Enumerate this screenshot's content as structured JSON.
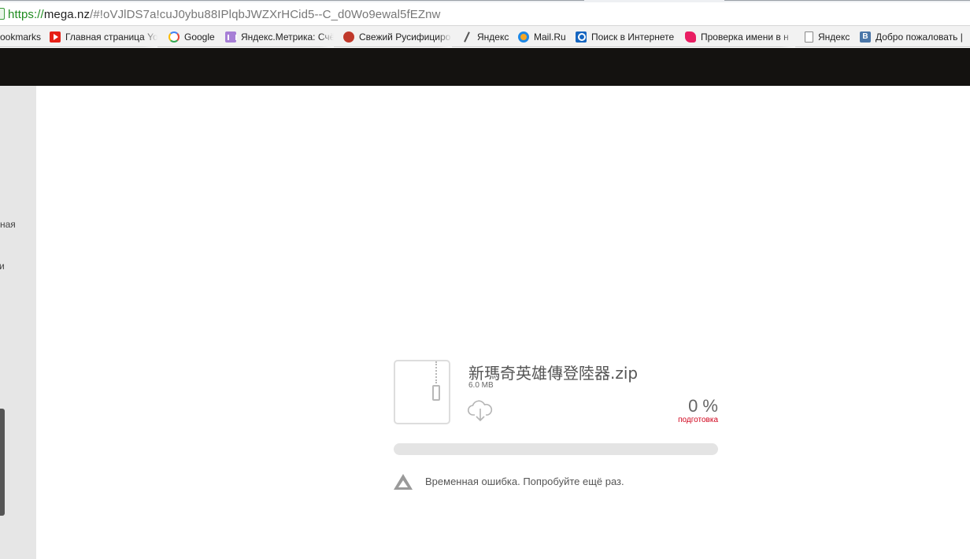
{
  "browser": {
    "url_scheme": "https://",
    "url_host": "mega.nz",
    "url_path": "/#!oVJlDS7a!cuJ0ybu88IPlqbJWZXrHCid5--C_d0Wo9ewal5fEZnw",
    "bookmarks": [
      {
        "label": "ookmarks",
        "icon": "none"
      },
      {
        "label": "Главная страница Yo",
        "icon": "youtube-icon"
      },
      {
        "label": "Google",
        "icon": "google-icon"
      },
      {
        "label": "Яндекс.Метрика: Счё",
        "icon": "metrika-icon"
      },
      {
        "label": "Свежий Русифициро",
        "icon": "rusifikator-icon"
      },
      {
        "label": "Яндекс",
        "icon": "pen-icon"
      },
      {
        "label": "Mail.Ru",
        "icon": "mailru-icon"
      },
      {
        "label": "Поиск в Интернете",
        "icon": "search-icon"
      },
      {
        "label": "Проверка имени в н",
        "icon": "pink-icon"
      },
      {
        "label": "Яндекс",
        "icon": "page-icon"
      },
      {
        "label": "Добро пожаловать |",
        "icon": "vk-icon"
      }
    ]
  },
  "left_panel": {
    "text_1": "ная",
    "text_2": "и"
  },
  "download": {
    "file_name": "新瑪奇英雄傳登陸器.zip",
    "file_size": "6.0 MB",
    "percent": "0 %",
    "status": "подготовка",
    "progress": 0,
    "error_message": "Временная ошибка. Попробуйте ещё раз."
  },
  "colors": {
    "header": "#141210",
    "status_red": "#d0021b",
    "progress_track": "#e4e4e4"
  }
}
